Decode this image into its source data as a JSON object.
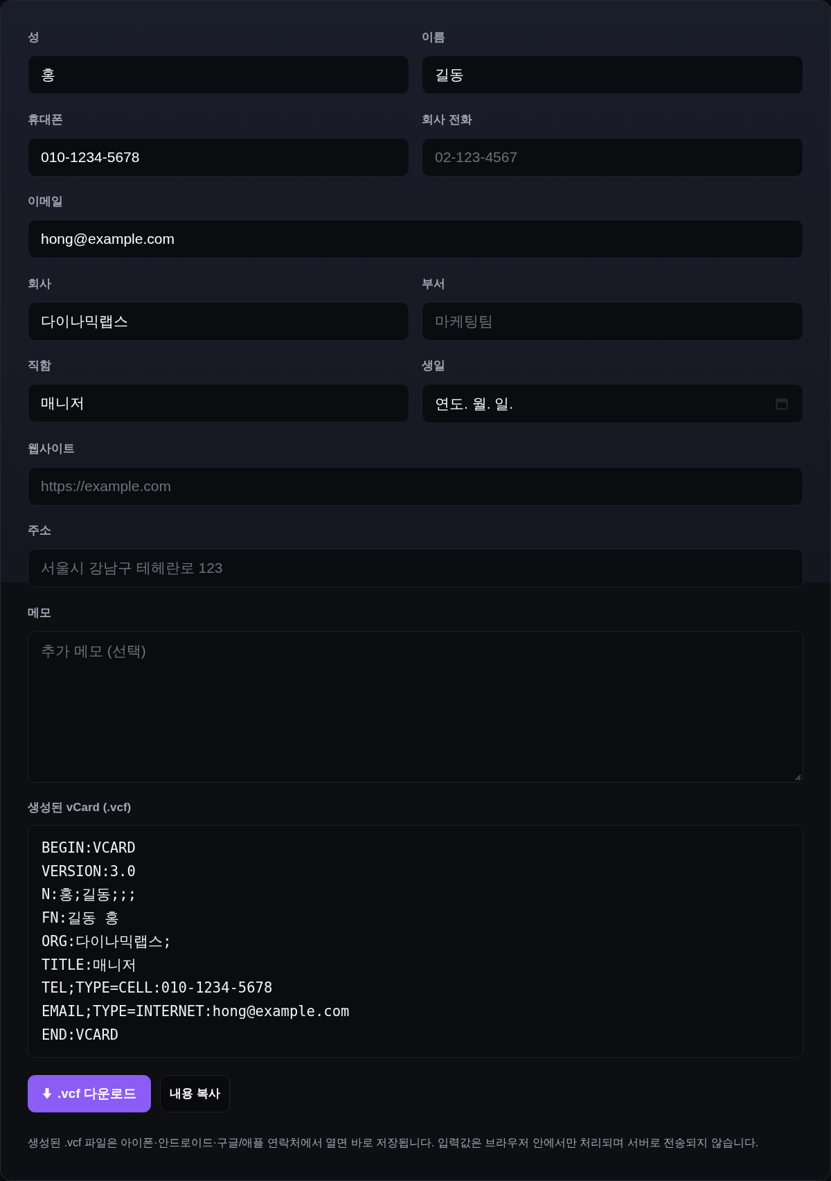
{
  "rows": [
    [
      {
        "kind": "text",
        "label": "성",
        "value": "홍"
      },
      {
        "kind": "text",
        "label": "이름",
        "value": "길동"
      }
    ],
    [
      {
        "kind": "text",
        "label": "휴대폰",
        "value": "010-1234-5678"
      },
      {
        "kind": "text",
        "label": "회사 전화",
        "placeholder": "02-123-4567"
      }
    ],
    [
      {
        "kind": "text",
        "label": "이메일",
        "value": "hong@example.com"
      }
    ],
    [
      {
        "kind": "text",
        "label": "회사",
        "value": "다이나믹랩스"
      },
      {
        "kind": "text",
        "label": "부서",
        "placeholder": "마케팅팀"
      }
    ],
    [
      {
        "kind": "text",
        "label": "직함",
        "value": "매니저"
      },
      {
        "kind": "date",
        "label": "생일",
        "value": "연도. 월. 일."
      }
    ],
    [
      {
        "kind": "text",
        "label": "웹사이트",
        "placeholder": "https://example.com"
      }
    ],
    [
      {
        "kind": "text",
        "label": "주소",
        "placeholder": "서울시 강남구 테헤란로 123"
      }
    ],
    [
      {
        "kind": "textarea",
        "label": "메모",
        "placeholder": "추가 메모 (선택)"
      }
    ]
  ],
  "vcard": {
    "label": "생성된 vCard (.vcf)",
    "lines": [
      "BEGIN:VCARD",
      "VERSION:3.0",
      "N:홍;길동;;;",
      "FN:길동 홍",
      "ORG:다이나믹랩스;",
      "TITLE:매니저",
      "TEL;TYPE=CELL:010-1234-5678",
      "EMAIL;TYPE=INTERNET:hong@example.com",
      "END:VCARD"
    ]
  },
  "buttons": [
    {
      "kind": "primary",
      "label": ".vcf 다운로드"
    },
    {
      "kind": "secondary",
      "label": "내용 복사"
    }
  ],
  "note": "생성된 .vcf 파일은 아이폰·안드로이드·구글/애플 연락처에서 열면 바로 저장됩니다. 입력값은 브라우저 안에서만 처리되며 서버로 전송되지 않습니다."
}
